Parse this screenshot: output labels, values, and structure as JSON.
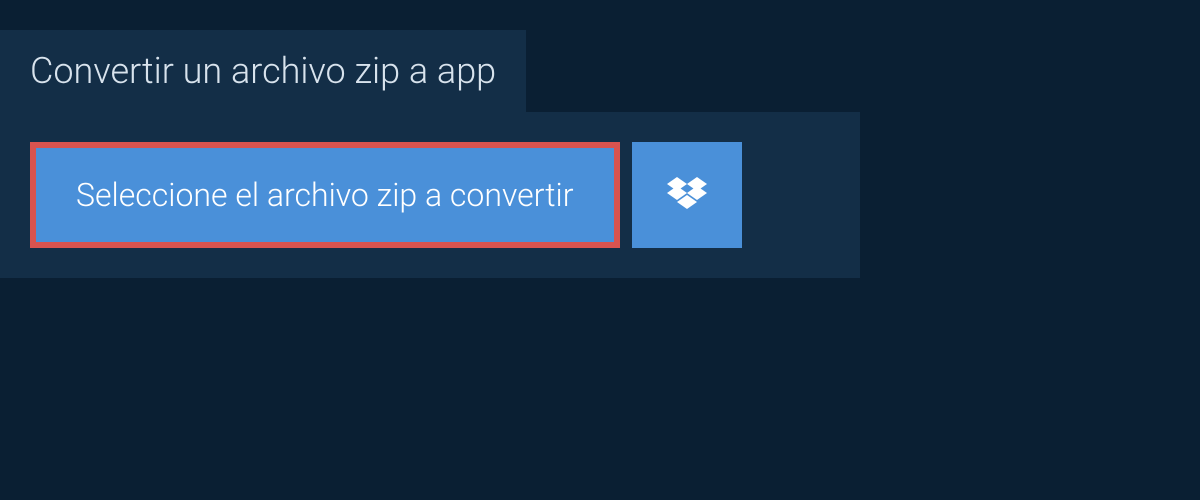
{
  "tab": {
    "title": "Convertir un archivo zip a app"
  },
  "buttons": {
    "select_file": "Seleccione el archivo zip a convertir"
  },
  "colors": {
    "background_dark": "#0a1f33",
    "panel": "#132e47",
    "button_blue": "#4a90d9",
    "highlight_border": "#d9534f"
  }
}
